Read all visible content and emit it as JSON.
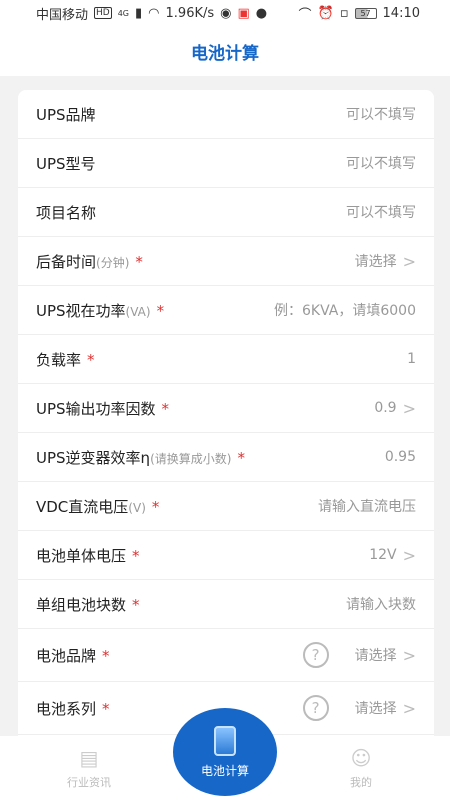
{
  "status": {
    "carrier": "中国移动",
    "hd": "HD",
    "network": "4G",
    "speed": "1.96K/s",
    "battery": "57",
    "time": "14:10"
  },
  "header": {
    "title": "电池计算"
  },
  "form": {
    "rows": [
      {
        "label": "UPS品牌",
        "hint": "",
        "required": "",
        "value": "可以不填写",
        "chevron": ""
      },
      {
        "label": "UPS型号",
        "hint": "",
        "required": "",
        "value": "可以不填写",
        "chevron": ""
      },
      {
        "label": "项目名称",
        "hint": "",
        "required": "",
        "value": "可以不填写",
        "chevron": ""
      },
      {
        "label": "后备时间",
        "hint": "(分钟)",
        "required": "*",
        "value": "请选择",
        "chevron": ">"
      },
      {
        "label": "UPS视在功率",
        "hint": "(VA)",
        "required": "*",
        "value": "例：6KVA，请填6000",
        "chevron": ""
      },
      {
        "label": "负载率",
        "hint": "",
        "required": "*",
        "value": "1",
        "chevron": ""
      },
      {
        "label": "UPS输出功率因数",
        "hint": "",
        "required": "*",
        "value": "0.9",
        "chevron": ">"
      },
      {
        "label": "UPS逆变器效率η",
        "hint": "(请换算成小数)",
        "required": "*",
        "value": "0.95",
        "chevron": ""
      },
      {
        "label": "VDC直流电压",
        "hint": "(V)",
        "required": "*",
        "value": "请输入直流电压",
        "chevron": ""
      },
      {
        "label": "电池单体电压",
        "hint": "",
        "required": "*",
        "value": "12V",
        "chevron": ">"
      },
      {
        "label": "单组电池块数",
        "hint": "",
        "required": "*",
        "value": "请输入块数",
        "chevron": ""
      },
      {
        "label": "电池品牌",
        "hint": "",
        "required": "*",
        "value": "请选择",
        "chevron": ">",
        "help": "?"
      },
      {
        "label": "电池系列",
        "hint": "",
        "required": "*",
        "value": "请选择",
        "chevron": ">",
        "help": "?"
      }
    ]
  },
  "tabbar": {
    "news_label": "行业资讯",
    "calc_label": "电池计算",
    "mine_label": "我的"
  }
}
